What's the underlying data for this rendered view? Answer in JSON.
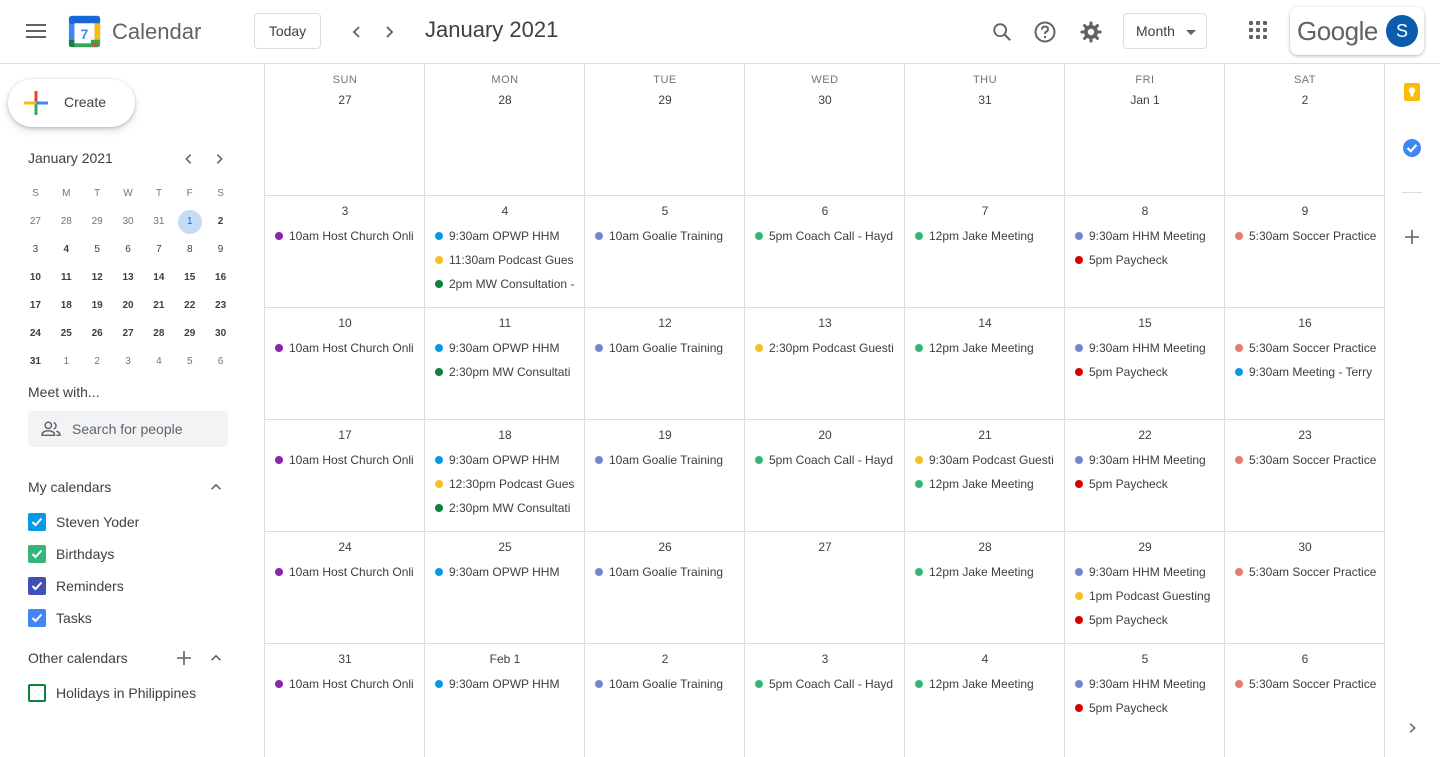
{
  "header": {
    "app_title": "Calendar",
    "logo_day": "7",
    "today_label": "Today",
    "period_title": "January 2021",
    "view_label": "Month",
    "brand": "Google",
    "avatar_letter": "S"
  },
  "sidebar": {
    "create_label": "Create",
    "mini_calendar": {
      "title": "January 2021",
      "weekday_heads": [
        "S",
        "M",
        "T",
        "W",
        "T",
        "F",
        "S"
      ],
      "weeks": [
        [
          "27",
          "28",
          "29",
          "30",
          "31",
          "1",
          "2"
        ],
        [
          "3",
          "4",
          "5",
          "6",
          "7",
          "8",
          "9"
        ],
        [
          "10",
          "11",
          "12",
          "13",
          "14",
          "15",
          "16"
        ],
        [
          "17",
          "18",
          "19",
          "20",
          "21",
          "22",
          "23"
        ],
        [
          "24",
          "25",
          "26",
          "27",
          "28",
          "29",
          "30"
        ],
        [
          "31",
          "1",
          "2",
          "3",
          "4",
          "5",
          "6"
        ]
      ]
    },
    "meet_title": "Meet with...",
    "search_placeholder": "Search for people",
    "my_calendars_title": "My calendars",
    "my_calendars": [
      {
        "label": "Steven Yoder",
        "color": "#039be5",
        "checked": true
      },
      {
        "label": "Birthdays",
        "color": "#33b679",
        "checked": true
      },
      {
        "label": "Reminders",
        "color": "#3f51b5",
        "checked": true
      },
      {
        "label": "Tasks",
        "color": "#4285f4",
        "checked": true
      }
    ],
    "other_calendars_title": "Other calendars",
    "other_calendars": [
      {
        "label": "Holidays in Philippines",
        "color": "#0b8043",
        "checked": false
      }
    ]
  },
  "colors": {
    "church": "#8e24aa",
    "opwp": "#039be5",
    "podcast": "#f6bf26",
    "consult": "#0b8043",
    "goalie": "#7986cb",
    "coach": "#33b679",
    "jake": "#33b679",
    "hhm": "#7986cb",
    "paycheck": "#d50000",
    "soccer": "#e67c73",
    "terry": "#039be5"
  },
  "month": {
    "weekday_heads": [
      "SUN",
      "MON",
      "TUE",
      "WED",
      "THU",
      "FRI",
      "SAT"
    ],
    "weeks": [
      [
        {
          "date": "27",
          "events": []
        },
        {
          "date": "28",
          "events": []
        },
        {
          "date": "29",
          "events": []
        },
        {
          "date": "30",
          "events": []
        },
        {
          "date": "31",
          "events": []
        },
        {
          "date": "Jan 1",
          "events": []
        },
        {
          "date": "2",
          "events": []
        }
      ],
      [
        {
          "date": "3",
          "events": [
            {
              "text": "10am Host Church Onli",
              "color": "#8e24aa"
            }
          ]
        },
        {
          "date": "4",
          "events": [
            {
              "text": "9:30am OPWP HHM",
              "color": "#039be5"
            },
            {
              "text": "11:30am Podcast Gues",
              "color": "#f6bf26"
            },
            {
              "text": "2pm MW Consultation -",
              "color": "#0b8043"
            }
          ]
        },
        {
          "date": "5",
          "events": [
            {
              "text": "10am Goalie Training",
              "color": "#7986cb"
            }
          ]
        },
        {
          "date": "6",
          "events": [
            {
              "text": "5pm Coach Call - Hayd",
              "color": "#33b679"
            }
          ]
        },
        {
          "date": "7",
          "events": [
            {
              "text": "12pm Jake Meeting",
              "color": "#33b679"
            }
          ]
        },
        {
          "date": "8",
          "events": [
            {
              "text": "9:30am HHM Meeting",
              "color": "#7986cb"
            },
            {
              "text": "5pm Paycheck",
              "color": "#d50000"
            }
          ]
        },
        {
          "date": "9",
          "events": [
            {
              "text": "5:30am Soccer Practice",
              "color": "#e67c73"
            }
          ]
        }
      ],
      [
        {
          "date": "10",
          "events": [
            {
              "text": "10am Host Church Onli",
              "color": "#8e24aa"
            }
          ]
        },
        {
          "date": "11",
          "events": [
            {
              "text": "9:30am OPWP HHM",
              "color": "#039be5"
            },
            {
              "text": "2:30pm MW Consultati",
              "color": "#0b8043"
            }
          ]
        },
        {
          "date": "12",
          "events": [
            {
              "text": "10am Goalie Training",
              "color": "#7986cb"
            }
          ]
        },
        {
          "date": "13",
          "events": [
            {
              "text": "2:30pm Podcast Guesti",
              "color": "#f6bf26"
            }
          ]
        },
        {
          "date": "14",
          "events": [
            {
              "text": "12pm Jake Meeting",
              "color": "#33b679"
            }
          ]
        },
        {
          "date": "15",
          "events": [
            {
              "text": "9:30am HHM Meeting",
              "color": "#7986cb"
            },
            {
              "text": "5pm Paycheck",
              "color": "#d50000"
            }
          ]
        },
        {
          "date": "16",
          "events": [
            {
              "text": "5:30am Soccer Practice",
              "color": "#e67c73"
            },
            {
              "text": "9:30am Meeting - Terry",
              "color": "#039be5"
            }
          ]
        }
      ],
      [
        {
          "date": "17",
          "events": [
            {
              "text": "10am Host Church Onli",
              "color": "#8e24aa"
            }
          ]
        },
        {
          "date": "18",
          "events": [
            {
              "text": "9:30am OPWP HHM",
              "color": "#039be5"
            },
            {
              "text": "12:30pm Podcast Gues",
              "color": "#f6bf26"
            },
            {
              "text": "2:30pm MW Consultati",
              "color": "#0b8043"
            }
          ]
        },
        {
          "date": "19",
          "events": [
            {
              "text": "10am Goalie Training",
              "color": "#7986cb"
            }
          ]
        },
        {
          "date": "20",
          "events": [
            {
              "text": "5pm Coach Call - Hayd",
              "color": "#33b679"
            }
          ]
        },
        {
          "date": "21",
          "events": [
            {
              "text": "9:30am Podcast Guesti",
              "color": "#f6bf26"
            },
            {
              "text": "12pm Jake Meeting",
              "color": "#33b679"
            }
          ]
        },
        {
          "date": "22",
          "events": [
            {
              "text": "9:30am HHM Meeting",
              "color": "#7986cb"
            },
            {
              "text": "5pm Paycheck",
              "color": "#d50000"
            }
          ]
        },
        {
          "date": "23",
          "events": [
            {
              "text": "5:30am Soccer Practice",
              "color": "#e67c73"
            }
          ]
        }
      ],
      [
        {
          "date": "24",
          "events": [
            {
              "text": "10am Host Church Onli",
              "color": "#8e24aa"
            }
          ]
        },
        {
          "date": "25",
          "events": [
            {
              "text": "9:30am OPWP HHM",
              "color": "#039be5"
            }
          ]
        },
        {
          "date": "26",
          "events": [
            {
              "text": "10am Goalie Training",
              "color": "#7986cb"
            }
          ]
        },
        {
          "date": "27",
          "events": []
        },
        {
          "date": "28",
          "events": [
            {
              "text": "12pm Jake Meeting",
              "color": "#33b679"
            }
          ]
        },
        {
          "date": "29",
          "events": [
            {
              "text": "9:30am HHM Meeting",
              "color": "#7986cb"
            },
            {
              "text": "1pm Podcast Guesting",
              "color": "#f6bf26"
            },
            {
              "text": "5pm Paycheck",
              "color": "#d50000"
            }
          ]
        },
        {
          "date": "30",
          "events": [
            {
              "text": "5:30am Soccer Practice",
              "color": "#e67c73"
            }
          ]
        }
      ],
      [
        {
          "date": "31",
          "events": [
            {
              "text": "10am Host Church Onli",
              "color": "#8e24aa"
            }
          ]
        },
        {
          "date": "Feb 1",
          "events": [
            {
              "text": "9:30am OPWP HHM",
              "color": "#039be5"
            }
          ]
        },
        {
          "date": "2",
          "events": [
            {
              "text": "10am Goalie Training",
              "color": "#7986cb"
            }
          ]
        },
        {
          "date": "3",
          "events": [
            {
              "text": "5pm Coach Call - Hayd",
              "color": "#33b679"
            }
          ]
        },
        {
          "date": "4",
          "events": [
            {
              "text": "12pm Jake Meeting",
              "color": "#33b679"
            }
          ]
        },
        {
          "date": "5",
          "events": [
            {
              "text": "9:30am HHM Meeting",
              "color": "#7986cb"
            },
            {
              "text": "5pm Paycheck",
              "color": "#d50000"
            }
          ]
        },
        {
          "date": "6",
          "events": [
            {
              "text": "5:30am Soccer Practice",
              "color": "#e67c73"
            }
          ]
        }
      ]
    ]
  },
  "rail": {
    "keep_color": "#fbbc04",
    "tasks_color": "#4285f4"
  }
}
